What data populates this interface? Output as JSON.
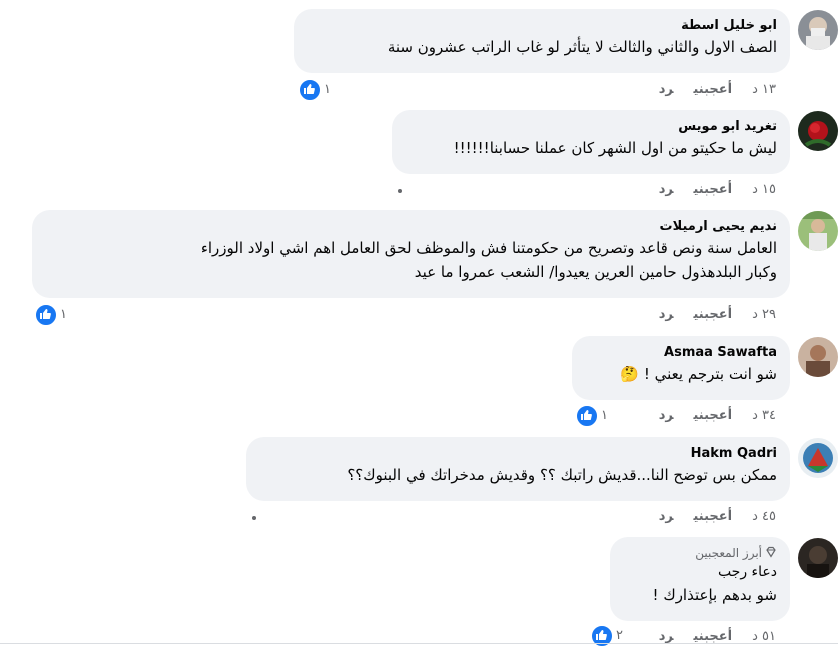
{
  "comments": [
    {
      "author": "ابو خليل اسطة",
      "lines": [
        "الصف الاول والثاني والثالث لا يتأثر لو غاب الراتب عشرون سنة"
      ],
      "time": "١٣ د",
      "like_label": "أعجبني",
      "reply_label": "رد",
      "reactions": "١"
    },
    {
      "author": "تغريد ابو مويس",
      "lines": [
        "ليش ما حكيتو من اول الشهر كان عملنا حسابنا!!!!!!"
      ],
      "time": "١٥ د",
      "like_label": "أعجبني",
      "reply_label": "رد"
    },
    {
      "author": "نديم يحيى ارميلات",
      "lines": [
        "العامل سنة ونص قاعد وتصريح من حكومتنا فش والموظف لحق العامل اهم اشي اولاد الوزراء",
        "وكبار البلدهذول حامين العرين يعيدوا/ الشعب عمروا ما عيد"
      ],
      "time": "٢٩ د",
      "like_label": "أعجبني",
      "reply_label": "رد",
      "reactions": "١"
    },
    {
      "author": "Asmaa Sawafta",
      "lines": [
        "شو انت بترجم يعني ! 🤔"
      ],
      "time": "٣٤ د",
      "like_label": "أعجبني",
      "reply_label": "رد",
      "reactions": "١"
    },
    {
      "author": "Hakm Qadri",
      "lines": [
        "ممكن بس توضح النا...قديش راتبك ؟؟ وقديش مدخراتك في البنوك؟؟"
      ],
      "time": "٤٥ د",
      "like_label": "أعجبني",
      "reply_label": "رد"
    },
    {
      "badge": "أبرز المعجبين",
      "author": "دعاء رجب",
      "lines": [
        "شو بدهم بإعتذارك !"
      ],
      "time": "٥١ د",
      "like_label": "أعجبني",
      "reply_label": "رد",
      "reactions": "٢"
    }
  ],
  "colors": {
    "bubble": "#f0f2f5",
    "like_blue": "#1877f2",
    "meta_gray": "#65676b"
  },
  "icons": {
    "like": "thumbs-up-icon",
    "badge": "diamond-icon",
    "more": "more-options-icon"
  }
}
